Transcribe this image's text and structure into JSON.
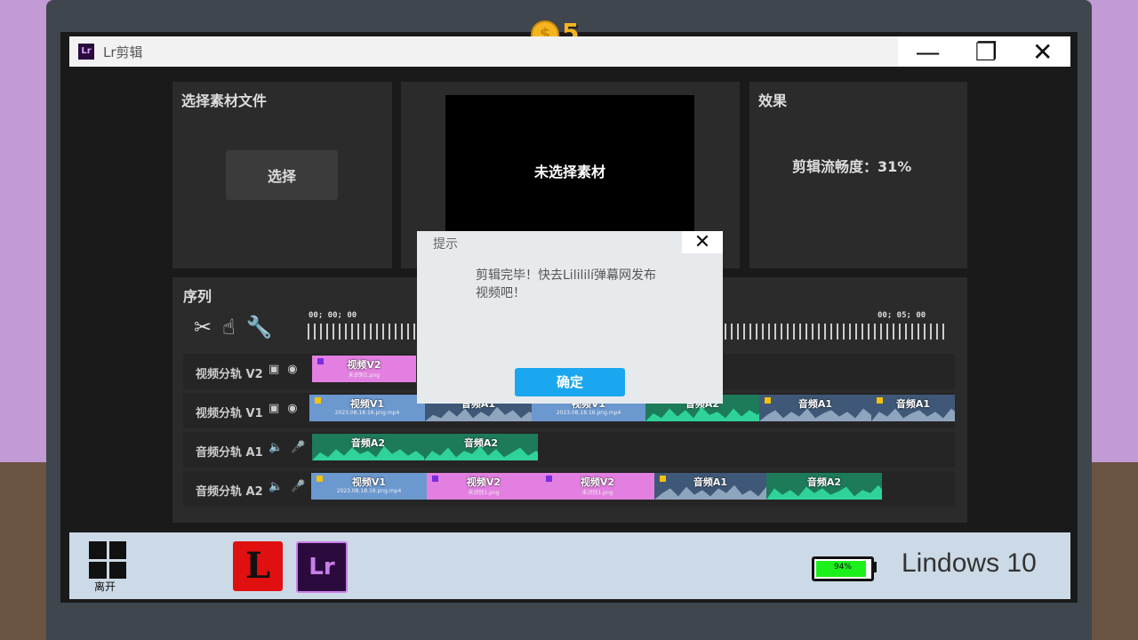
{
  "coins": {
    "count": "5",
    "icon": "coin-icon"
  },
  "window": {
    "app_icon": "Lr",
    "title": "Lr剪辑",
    "minimize": "—",
    "restore": "❐",
    "close": "✕"
  },
  "select_panel": {
    "title": "选择素材文件",
    "button": "选择"
  },
  "preview_panel": {
    "text": "未选择素材"
  },
  "effect_panel": {
    "title": "效果",
    "text": "剪辑流畅度：31%"
  },
  "sequence": {
    "title": "序列",
    "tools": [
      "scissors-icon",
      "hand-icon",
      "wrench-icon"
    ],
    "timecodes": [
      "00; 00; 00",
      "00; 05; 00"
    ],
    "tracks": [
      {
        "label": "视频分轨 V2"
      },
      {
        "label": "视频分轨 V1"
      },
      {
        "label": "音频分轨 A1"
      },
      {
        "label": "音频分轨 A2"
      }
    ],
    "clips": {
      "v2_1": "视频V2",
      "v2_1_sub": "未识别1.png",
      "v1_1": "视频V1",
      "v1_1_sub": "2023.08.18.16.png.mp4",
      "v1_2": "音频A1",
      "v1_3": "视频V1",
      "v1_3_sub": "2023.08.18.16.png.mp4",
      "v1_4": "音频A2",
      "v1_5": "音频A1",
      "v1_6": "音频A1",
      "a1_1": "音频A2",
      "a1_2": "音频A2",
      "a2_1": "视频V1",
      "a2_1_sub": "2023.08.18.16.png.mp4",
      "a2_2": "视频V2",
      "a2_2_sub": "未识别1.png",
      "a2_3": "视频V2",
      "a2_3_sub": "未识别1.png",
      "a2_4": "音频A1",
      "a2_5": "音频A2"
    }
  },
  "dialog": {
    "title": "提示",
    "close": "✕",
    "message": "剪辑完毕！快去Lilililí弹幕网发布视频吧！",
    "ok": "确定"
  },
  "taskbar": {
    "leave": "离开",
    "app1": "L",
    "app2": "Lr",
    "battery": "94%",
    "battery_level": 0.94,
    "os": "Lindows 10"
  }
}
